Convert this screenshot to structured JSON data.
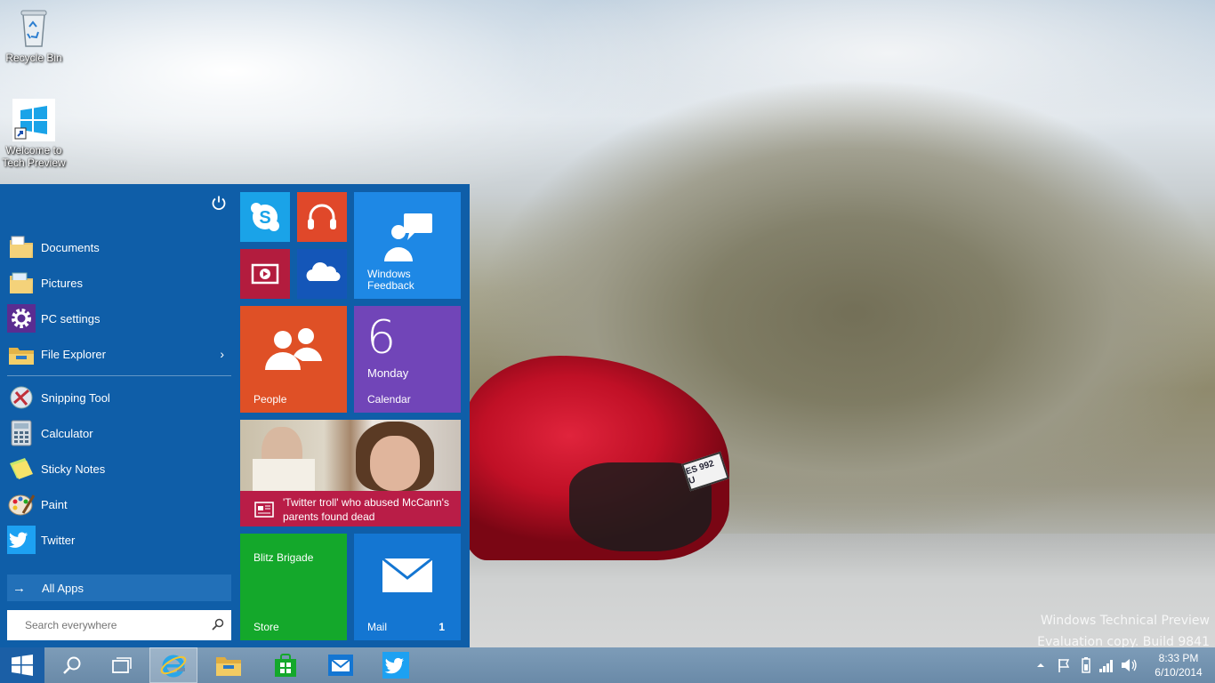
{
  "desktop": {
    "icons": [
      {
        "label": "Recycle Bin",
        "icon": "recycle-bin-icon"
      },
      {
        "label": "Welcome to Tech Preview",
        "icon": "windows-logo-shortcut-icon"
      }
    ],
    "watermark": {
      "line1": "Windows Technical Preview",
      "line2": "Evaluation copy. Build 9841"
    },
    "wallpaper": {
      "plate_text": "ES 992 U"
    }
  },
  "start_menu": {
    "power_icon": "power-icon",
    "places": [
      {
        "label": "Documents",
        "icon": "documents-folder-icon"
      },
      {
        "label": "Pictures",
        "icon": "pictures-folder-icon"
      },
      {
        "label": "PC settings",
        "icon": "gear-icon"
      },
      {
        "label": "File Explorer",
        "icon": "file-explorer-icon",
        "has_submenu": true
      }
    ],
    "apps": [
      {
        "label": "Snipping Tool",
        "icon": "snipping-tool-icon"
      },
      {
        "label": "Calculator",
        "icon": "calculator-icon"
      },
      {
        "label": "Sticky Notes",
        "icon": "sticky-notes-icon"
      },
      {
        "label": "Paint",
        "icon": "paint-palette-icon"
      },
      {
        "label": "Twitter",
        "icon": "twitter-bird-icon"
      }
    ],
    "all_apps_label": "All Apps",
    "search_placeholder": "Search everywhere",
    "tiles": {
      "skype": {
        "icon": "skype-icon"
      },
      "music": {
        "icon": "headphones-icon"
      },
      "video": {
        "icon": "video-play-icon"
      },
      "onedrive": {
        "icon": "cloud-icon"
      },
      "feedback": {
        "label": "Windows Feedback",
        "icon": "feedback-person-icon"
      },
      "people": {
        "label": "People",
        "icon": "people-icon"
      },
      "calendar": {
        "label": "Calendar",
        "day_number": "6",
        "weekday": "Monday"
      },
      "news": {
        "headline": "'Twitter troll' who abused McCann's parents found dead",
        "icon": "newspaper-icon"
      },
      "store": {
        "title": "Blitz Brigade",
        "label": "Store"
      },
      "mail": {
        "label": "Mail",
        "count": "1",
        "icon": "envelope-icon"
      }
    }
  },
  "taskbar": {
    "pinned": [
      {
        "name": "search",
        "icon": "magnifier-icon"
      },
      {
        "name": "task-view",
        "icon": "task-view-icon"
      },
      {
        "name": "internet-explorer",
        "icon": "internet-explorer-icon",
        "active": true
      },
      {
        "name": "file-explorer",
        "icon": "folder-icon"
      },
      {
        "name": "store",
        "icon": "store-bag-icon"
      },
      {
        "name": "mail",
        "icon": "envelope-icon"
      },
      {
        "name": "twitter",
        "icon": "twitter-bird-icon"
      }
    ],
    "tray": {
      "icons": [
        "chevron-up-icon",
        "flag-icon",
        "battery-icon",
        "network-signal-icon",
        "speaker-icon"
      ],
      "time": "8:33 PM",
      "date": "6/10/2014"
    }
  },
  "colors": {
    "start_bg": "#0f5ea8",
    "skype": "#1aa3e8",
    "music": "#e0482a",
    "video": "#b31c3e",
    "onedrive": "#1456b8",
    "feedback": "#1e88e5",
    "people": "#df5026",
    "calendar": "#7145b8",
    "news": "#b91d47",
    "store": "#14a82b",
    "mail": "#1476d2"
  }
}
